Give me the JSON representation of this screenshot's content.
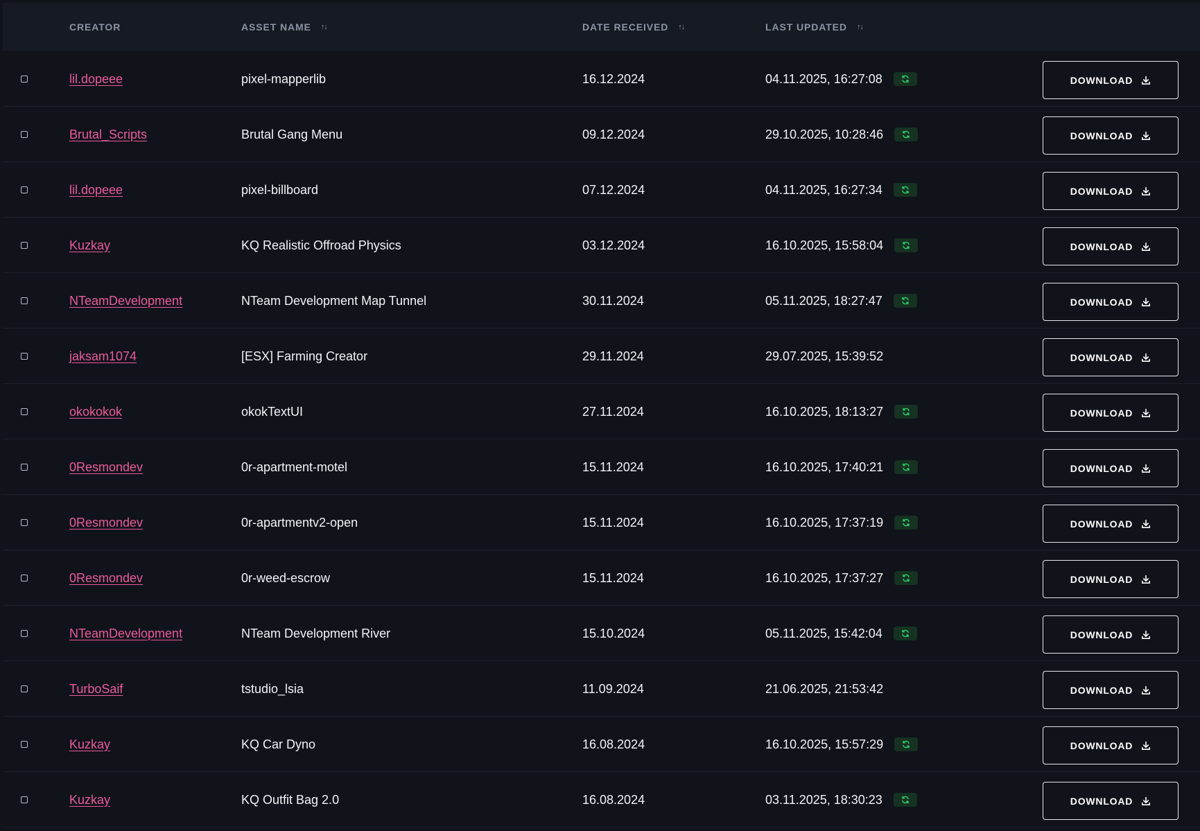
{
  "header": {
    "creator": "CREATOR",
    "asset_name": "ASSET NAME",
    "date_received": "DATE RECEIVED",
    "last_updated": "LAST UPDATED",
    "sort_icon": "sort-arrows-icon"
  },
  "icons": {
    "update": "refresh-icon",
    "download": "download-icon"
  },
  "colors": {
    "creator_link": "#ec5b9b",
    "update_badge_bg": "#163222",
    "update_badge_icon": "#2fd06e"
  },
  "download_label": "DOWNLOAD",
  "rows": [
    {
      "creator": "lil.dopeee",
      "asset": "pixel-mapperlib",
      "received": "16.12.2024",
      "updated": "04.11.2025, 16:27:08",
      "has_update": true
    },
    {
      "creator": "Brutal_Scripts",
      "asset": "Brutal Gang Menu",
      "received": "09.12.2024",
      "updated": "29.10.2025, 10:28:46",
      "has_update": true
    },
    {
      "creator": "lil.dopeee",
      "asset": "pixel-billboard",
      "received": "07.12.2024",
      "updated": "04.11.2025, 16:27:34",
      "has_update": true
    },
    {
      "creator": "Kuzkay",
      "asset": "KQ Realistic Offroad Physics",
      "received": "03.12.2024",
      "updated": "16.10.2025, 15:58:04",
      "has_update": true
    },
    {
      "creator": "NTeamDevelopment",
      "asset": "NTeam Development Map Tunnel",
      "received": "30.11.2024",
      "updated": "05.11.2025, 18:27:47",
      "has_update": true
    },
    {
      "creator": "jaksam1074",
      "asset": "[ESX] Farming Creator",
      "received": "29.11.2024",
      "updated": "29.07.2025, 15:39:52",
      "has_update": false
    },
    {
      "creator": "okokokok",
      "asset": "okokTextUI",
      "received": "27.11.2024",
      "updated": "16.10.2025, 18:13:27",
      "has_update": true
    },
    {
      "creator": "0Resmondev",
      "asset": "0r-apartment-motel",
      "received": "15.11.2024",
      "updated": "16.10.2025, 17:40:21",
      "has_update": true
    },
    {
      "creator": "0Resmondev",
      "asset": "0r-apartmentv2-open",
      "received": "15.11.2024",
      "updated": "16.10.2025, 17:37:19",
      "has_update": true
    },
    {
      "creator": "0Resmondev",
      "asset": "0r-weed-escrow",
      "received": "15.11.2024",
      "updated": "16.10.2025, 17:37:27",
      "has_update": true
    },
    {
      "creator": "NTeamDevelopment",
      "asset": "NTeam Development River",
      "received": "15.10.2024",
      "updated": "05.11.2025, 15:42:04",
      "has_update": true
    },
    {
      "creator": "TurboSaif",
      "asset": "tstudio_lsia",
      "received": "11.09.2024",
      "updated": "21.06.2025, 21:53:42",
      "has_update": false
    },
    {
      "creator": "Kuzkay",
      "asset": "KQ Car Dyno",
      "received": "16.08.2024",
      "updated": "16.10.2025, 15:57:29",
      "has_update": true
    },
    {
      "creator": "Kuzkay",
      "asset": "KQ Outfit Bag 2.0",
      "received": "16.08.2024",
      "updated": "03.11.2025, 18:30:23",
      "has_update": true
    }
  ]
}
